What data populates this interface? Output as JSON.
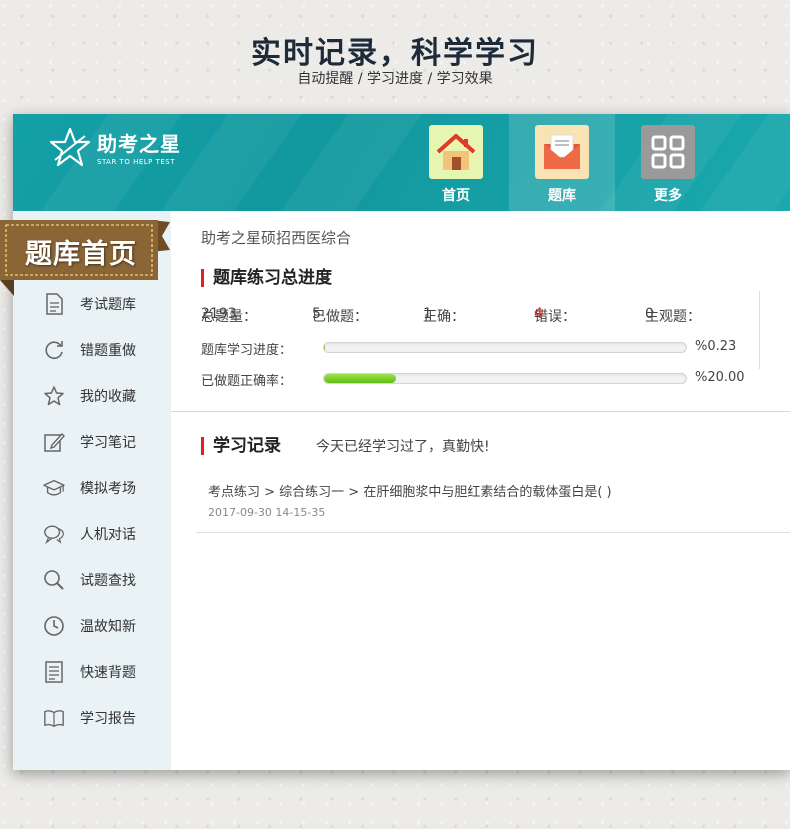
{
  "hero": {
    "title": "实时记录，科学学习",
    "subtitle": "自动提醒 / 学习进度 / 学习效果"
  },
  "logo": {
    "name": "助考之星",
    "tagline": "STAR TO HELP TEST"
  },
  "nav": {
    "items": [
      {
        "label": "首页",
        "icon": "home-icon",
        "active": false
      },
      {
        "label": "题库",
        "icon": "mail-icon",
        "active": true
      },
      {
        "label": "更多",
        "icon": "grid-icon",
        "active": false
      }
    ]
  },
  "sidebar": {
    "ribbon_label": "题库首页",
    "items": [
      {
        "label": "考试题库",
        "icon": "document-icon"
      },
      {
        "label": "错题重做",
        "icon": "refresh-icon"
      },
      {
        "label": "我的收藏",
        "icon": "star-icon"
      },
      {
        "label": "学习笔记",
        "icon": "pencil-icon"
      },
      {
        "label": "模拟考场",
        "icon": "graduation-cap-icon"
      },
      {
        "label": "人机对话",
        "icon": "chat-icon"
      },
      {
        "label": "试题查找",
        "icon": "search-icon"
      },
      {
        "label": "温故知新",
        "icon": "clock-icon"
      },
      {
        "label": "快速背题",
        "icon": "list-icon"
      },
      {
        "label": "学习报告",
        "icon": "book-icon"
      }
    ]
  },
  "main": {
    "bank_name": "助考之星硕招西医综合",
    "progress_title": "题库练习总进度",
    "stats": {
      "total_label": "总题量：",
      "total_value": "2193",
      "done_label": "已做题：",
      "done_value": "5",
      "correct_label": "正确：",
      "correct_value": "1",
      "wrong_label": "错误：",
      "wrong_value": "4",
      "subjective_label": "主观题：",
      "subjective_value": "0"
    },
    "progress": [
      {
        "label": "题库学习进度：",
        "percent_text": "%0.23",
        "percent": 0.23
      },
      {
        "label": "已做题正确率：",
        "percent_text": "%20.00",
        "percent": 20.0
      }
    ],
    "record_title": "学习记录",
    "record_note": "今天已经学习过了，真勤快!",
    "records": [
      {
        "path": "考点练习 > 综合练习一 > 在肝细胞浆中与胆红素结合的载体蛋白是( )",
        "time": "2017-09-30 14-15-35"
      }
    ]
  },
  "colors": {
    "header_teal": "#13a0a6",
    "accent_red": "#e02020",
    "sidebar_bg": "#e9f2f4",
    "progress_green": "#5fbf15",
    "ribbon_brown": "#8a6536"
  }
}
